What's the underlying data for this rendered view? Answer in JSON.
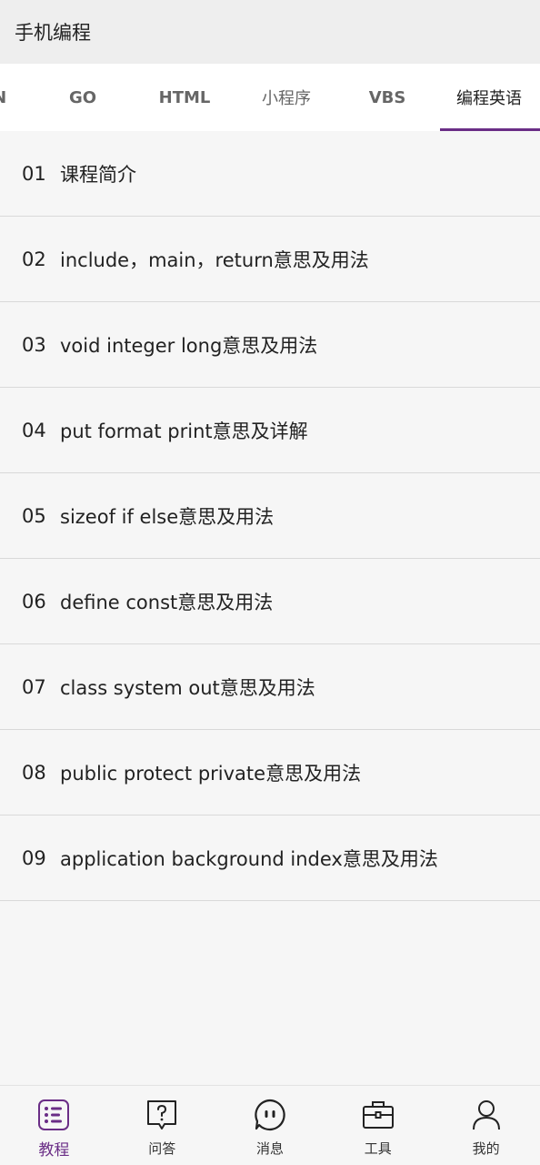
{
  "header": {
    "title": "手机编程"
  },
  "tabs": [
    {
      "label": "ON"
    },
    {
      "label": "GO"
    },
    {
      "label": "HTML"
    },
    {
      "label": "小程序"
    },
    {
      "label": "VBS"
    },
    {
      "label": "编程英语"
    }
  ],
  "list": [
    {
      "num": "01",
      "text": "课程简介"
    },
    {
      "num": "02",
      "text": "include，main，return意思及用法"
    },
    {
      "num": "03",
      "text": "void integer long意思及用法"
    },
    {
      "num": "04",
      "text": "put format print意思及详解"
    },
    {
      "num": "05",
      "text": "sizeof if else意思及用法"
    },
    {
      "num": "06",
      "text": "define const意思及用法"
    },
    {
      "num": "07",
      "text": "class system out意思及用法"
    },
    {
      "num": "08",
      "text": "public protect private意思及用法"
    },
    {
      "num": "09",
      "text": "application background index意思及用法"
    }
  ],
  "bottom_nav": [
    {
      "label": "教程",
      "icon": "list-icon"
    },
    {
      "label": "问答",
      "icon": "question-icon"
    },
    {
      "label": "消息",
      "icon": "chat-icon"
    },
    {
      "label": "工具",
      "icon": "toolbox-icon"
    },
    {
      "label": "我的",
      "icon": "user-icon"
    }
  ],
  "colors": {
    "accent": "#6a2d86",
    "background": "#f6f6f6",
    "header": "#eeeeee"
  }
}
